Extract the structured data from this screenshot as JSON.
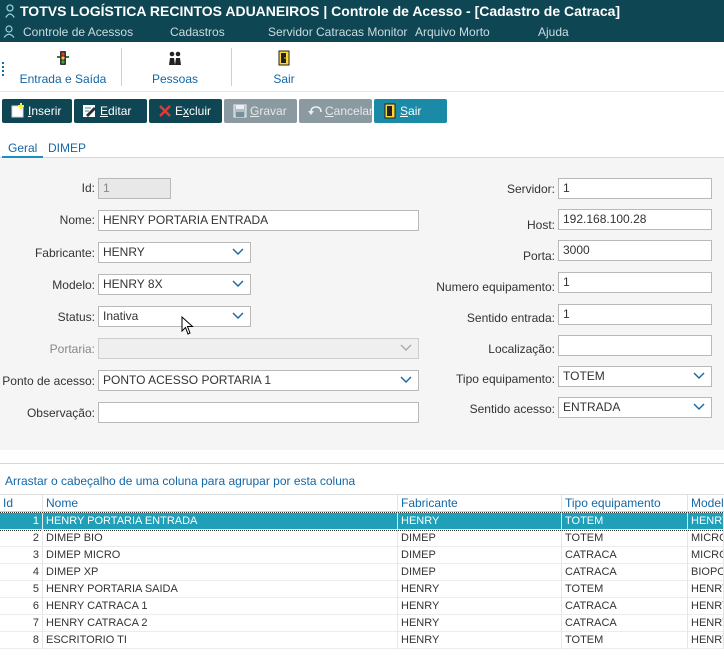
{
  "window": {
    "title": "TOTVS LOGÍSTICA RECINTOS ADUANEIROS | Controle de Acesso - [Cadastro de Catraca]"
  },
  "menu": [
    {
      "label": "Controle de Acessos"
    },
    {
      "label": "Cadastros"
    },
    {
      "label": "Servidor Catracas Monitor"
    },
    {
      "label": "Arquivo Morto"
    },
    {
      "label": "Ajuda"
    }
  ],
  "quickbar": [
    {
      "label": "Entrada e Saída",
      "icon": "traffic-light-icon"
    },
    {
      "label": "Pessoas",
      "icon": "people-icon"
    },
    {
      "label": "Sair",
      "icon": "exit-door-icon"
    }
  ],
  "toolbar": {
    "inserir": {
      "accel": "I",
      "rest": "nserir"
    },
    "editar": {
      "accel": "E",
      "rest": "ditar"
    },
    "excluir": {
      "pre": "E",
      "accel": "x",
      "rest": "cluir"
    },
    "gravar": {
      "accel": "G",
      "rest": "ravar"
    },
    "cancelar": {
      "accel": "C",
      "rest": "ancelar"
    },
    "sair": {
      "accel": "S",
      "rest": "air"
    }
  },
  "tabs": [
    {
      "label": "Geral",
      "active": true
    },
    {
      "label": "DIMEP",
      "active": false
    }
  ],
  "form": {
    "id": {
      "label": "Id:",
      "value": "1"
    },
    "nome": {
      "label": "Nome:",
      "value": "HENRY PORTARIA ENTRADA"
    },
    "fabricante": {
      "label": "Fabricante:",
      "value": "HENRY"
    },
    "modelo": {
      "label": "Modelo:",
      "value": "HENRY 8X"
    },
    "status": {
      "label": "Status:",
      "value": "Inativa"
    },
    "portaria": {
      "label": "Portaria:",
      "value": ""
    },
    "ponto_acesso": {
      "label": "Ponto de acesso:",
      "value": "PONTO ACESSO PORTARIA 1"
    },
    "observacao": {
      "label": "Observação:",
      "value": ""
    },
    "servidor": {
      "label": "Servidor:",
      "value": "1"
    },
    "host": {
      "label": "Host:",
      "value": "192.168.100.28"
    },
    "porta": {
      "label": "Porta:",
      "value": "3000"
    },
    "numero_equipamento": {
      "label": "Numero equipamento:",
      "value": "1"
    },
    "sentido_entrada": {
      "label": "Sentido entrada:",
      "value": "1"
    },
    "localizacao": {
      "label": "Localização:",
      "value": ""
    },
    "tipo_equipamento": {
      "label": "Tipo equipamento:",
      "value": "TOTEM"
    },
    "sentido_acesso": {
      "label": "Sentido acesso:",
      "value": "ENTRADA"
    }
  },
  "grid": {
    "group_hint": "Arrastar o cabeçalho de uma coluna para agrupar por esta coluna",
    "columns": [
      "Id",
      "Nome",
      "Fabricante",
      "Tipo equipamento",
      "Modelo"
    ],
    "rows": [
      {
        "id": "1",
        "nome": "HENRY PORTARIA ENTRADA",
        "fabricante": "HENRY",
        "tipo": "TOTEM",
        "modelo": "HENRY",
        "selected": true
      },
      {
        "id": "2",
        "nome": "DIMEP BIO",
        "fabricante": "DIMEP",
        "tipo": "TOTEM",
        "modelo": "MICRO"
      },
      {
        "id": "3",
        "nome": "DIMEP MICRO",
        "fabricante": "DIMEP",
        "tipo": "CATRACA",
        "modelo": "MICRO"
      },
      {
        "id": "4",
        "nome": "DIMEP XP",
        "fabricante": "DIMEP",
        "tipo": "CATRACA",
        "modelo": "BIOPO"
      },
      {
        "id": "5",
        "nome": "HENRY PORTARIA SAIDA",
        "fabricante": "HENRY",
        "tipo": "TOTEM",
        "modelo": "HENRY"
      },
      {
        "id": "6",
        "nome": "HENRY CATRACA 1",
        "fabricante": "HENRY",
        "tipo": "CATRACA",
        "modelo": "HENRY"
      },
      {
        "id": "7",
        "nome": "HENRY CATRACA 2",
        "fabricante": "HENRY",
        "tipo": "CATRACA",
        "modelo": "HENRY"
      },
      {
        "id": "8",
        "nome": "ESCRITORIO TI",
        "fabricante": "HENRY",
        "tipo": "TOTEM",
        "modelo": "HENRY"
      }
    ]
  }
}
